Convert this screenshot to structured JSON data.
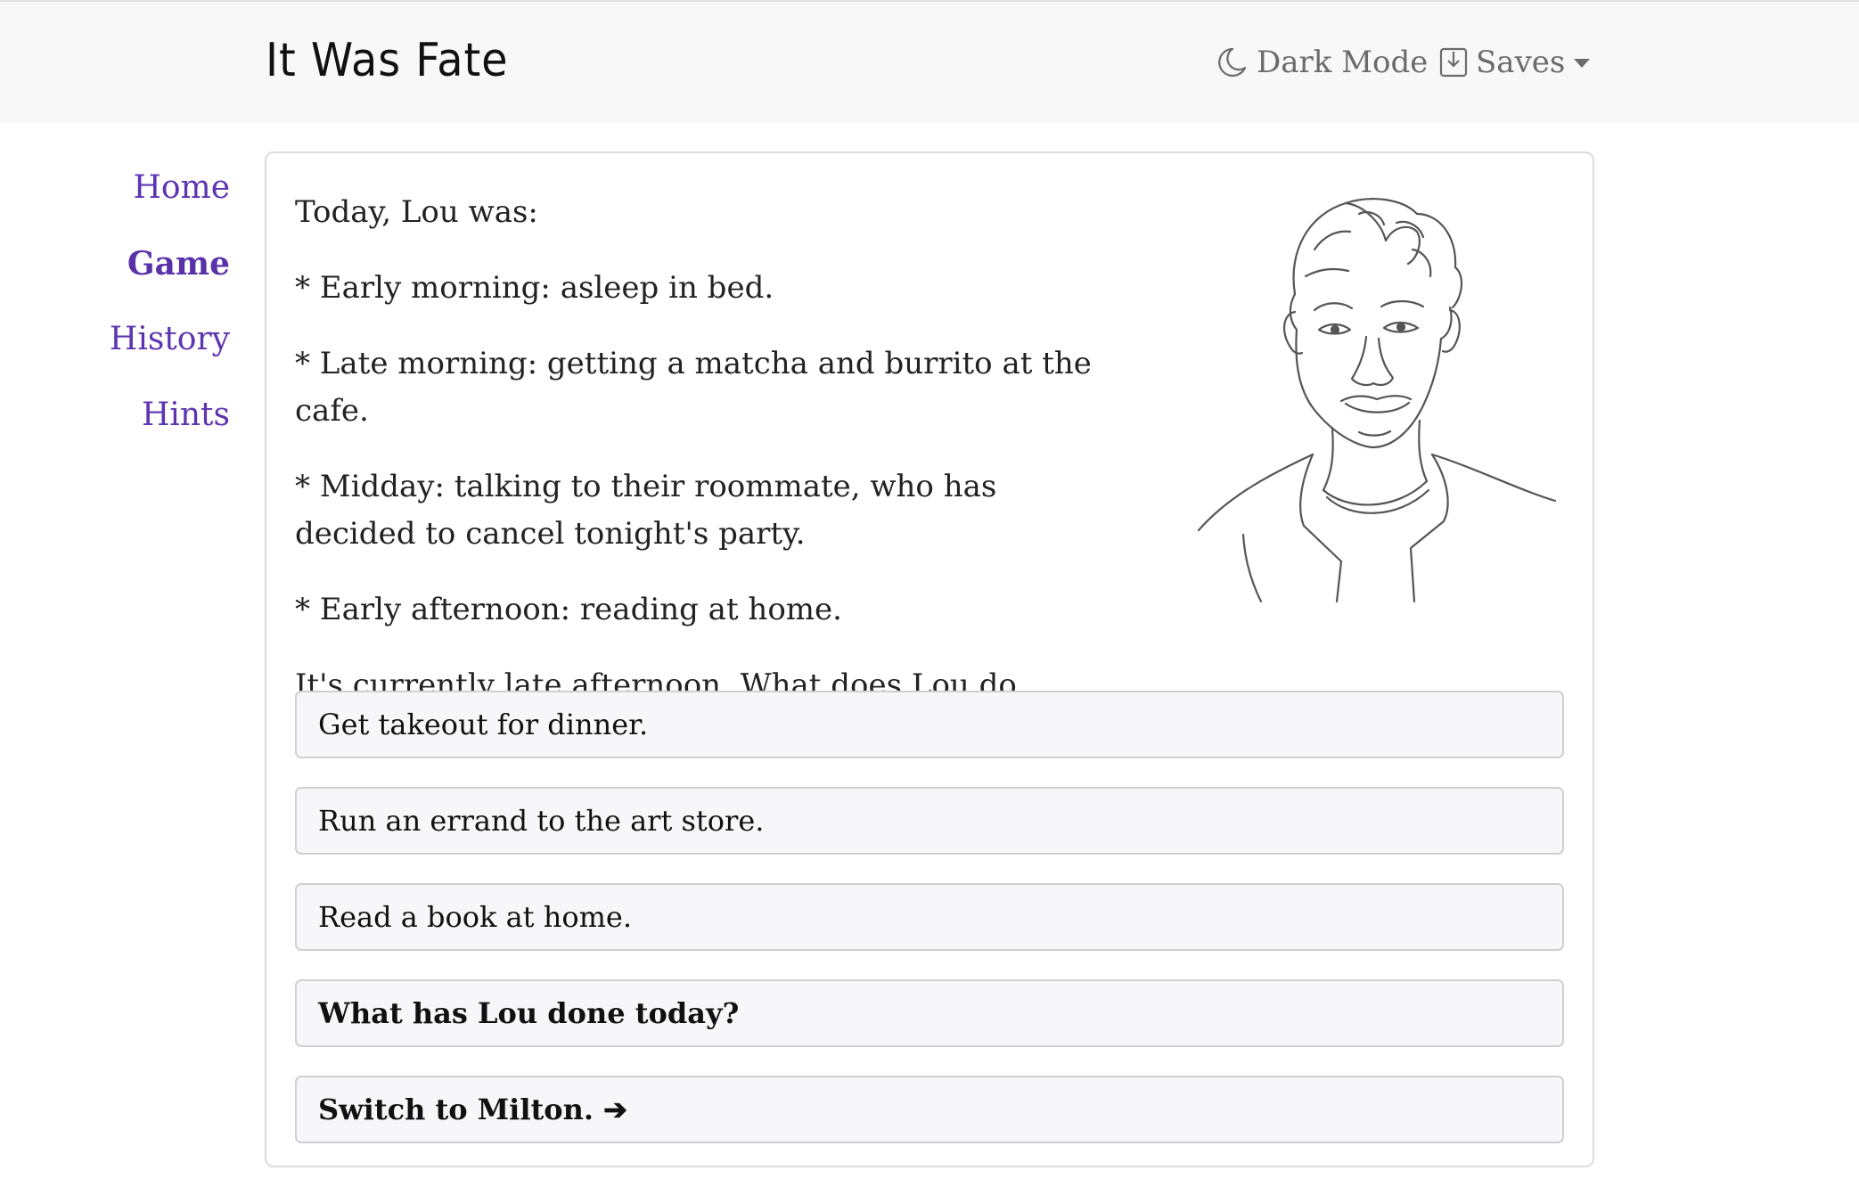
{
  "header": {
    "brand": "It Was Fate",
    "dark_mode_label": "Dark Mode",
    "saves_label": "Saves"
  },
  "sidebar": {
    "items": [
      {
        "label": "Home"
      },
      {
        "label": "Game"
      },
      {
        "label": "History"
      },
      {
        "label": "Hints"
      }
    ],
    "active": "Game"
  },
  "story": {
    "intro": "Today, Lou was:",
    "events": [
      "* Early morning: asleep in bed.",
      "* Late morning: getting a matcha and burrito at the cafe.",
      "* Midday: talking to their roommate, who has decided to cancel tonight's party.",
      "* Early afternoon: reading at home."
    ],
    "prompt": "It's currently late afternoon. What does Lou do next?"
  },
  "choices": [
    {
      "label": "Get takeout for dinner."
    },
    {
      "label": "Run an errand to the art store."
    },
    {
      "label": "Read a book at home."
    },
    {
      "label": "What has Lou done today?"
    },
    {
      "label": "Switch to Milton. ➔"
    }
  ],
  "icons": {
    "dark_mode": "moon-icon",
    "saves": "save-download-icon",
    "saves_menu": "caret-down-icon"
  },
  "colors": {
    "link": "#5e35b1",
    "topbar_bg": "#f8f8f9",
    "choice_bg": "#f7f7f9"
  }
}
